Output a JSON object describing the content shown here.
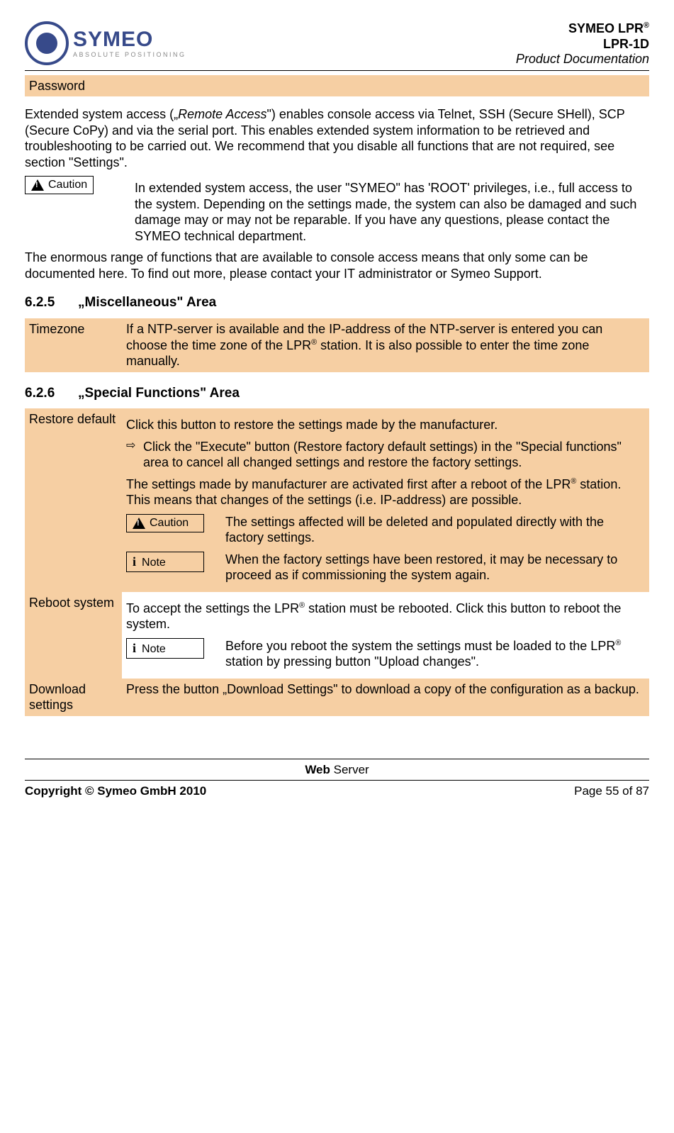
{
  "header": {
    "logo_name": "SYMEO",
    "logo_tag": "ABSOLUTE POSITIONING",
    "line1a": "SYMEO LPR",
    "line1b": "®",
    "line2": "LPR-1D",
    "line3": "Product Documentation"
  },
  "password_row": {
    "label": "Password",
    "content": ""
  },
  "para1a": "Extended system access („",
  "para1b": "Remote Access",
  "para1c": "\") enables console access via Telnet, SSH (Secure SHell), SCP (Secure CoPy) and via the serial port. This enables extended system information to be retrieved and troubleshooting to be carried out. We recommend that you disable all functions that are not required, see section \"Settings\".",
  "caution_label": "Caution",
  "note_label": "Note",
  "caution1": "In extended system access, the user \"SYMEO\" has 'ROOT' privileges, i.e., full access to the system. Depending on the settings made, the system can also be damaged and such damage may or may not be reparable. If you have any questions, please contact the SYMEO technical department.",
  "para2": "The enormous range of functions that are available to console access means that only some can be documented here. To find out more, please contact your IT administrator or Symeo Support.",
  "sec625_num": "6.2.5",
  "sec625_title": "„Miscellaneous\" Area",
  "timezone": {
    "label": "Timezone",
    "text1": "If a NTP-server is available and the IP-address of the NTP-server is entered you can choose the time zone of the LPR",
    "sup": "®",
    "text2": " station. It is also possible to enter the time zone manually."
  },
  "sec626_num": "6.2.6",
  "sec626_title": "„Special Functions\" Area",
  "restore": {
    "label": "Restore default",
    "p1": "Click this button to restore the settings made by the manufacturer.",
    "arrow": "Click the \"Execute\" button (Restore factory default settings) in the \"Special functions\" area to cancel all changed settings and restore the factory settings.",
    "p2a": "The settings made by manufacturer are activated first after a reboot of the LPR",
    "p2b": " station. This means that changes of the settings (i.e. IP-address) are possible.",
    "caution": "The settings affected will be deleted and populated directly with the factory settings.",
    "note": "When the factory settings have been restored, it may be necessary to proceed as if commissioning the system again."
  },
  "reboot": {
    "label": "Reboot system",
    "p1a": "To accept the settings the LPR",
    "p1b": " station must be rebooted. Click this button to reboot the system.",
    "note_a": "Before you reboot the system the settings must be loaded to the LPR",
    "note_b": " station by pressing button \"Upload changes\"."
  },
  "download": {
    "label": "Download settings",
    "text": "Press the button „Download Settings\" to download a copy of the configuration as a backup."
  },
  "footer": {
    "center_bold": "Web",
    "center_rest": " Server",
    "copyright": "Copyright © Symeo GmbH 2010",
    "page": "Page 55 of 87"
  }
}
